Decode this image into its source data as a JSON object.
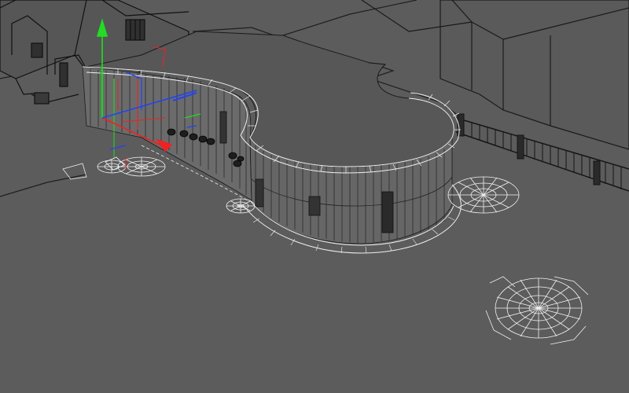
{
  "viewport": {
    "background_color": "#5c5c5c",
    "wire_color": "#ffffff",
    "edge_color": "#1a1a1a",
    "cladding_color": "#6a6a6a",
    "gizmo": {
      "y_axis_color": "#22dd22",
      "x_axis_color": "#ee2222",
      "z_axis_color": "#2244ee"
    },
    "objects": [
      "ground-plane",
      "existing-house",
      "curved-pavilion",
      "pavilion-roof",
      "perimeter-fence",
      "paving-rings",
      "transform-gizmo"
    ]
  }
}
